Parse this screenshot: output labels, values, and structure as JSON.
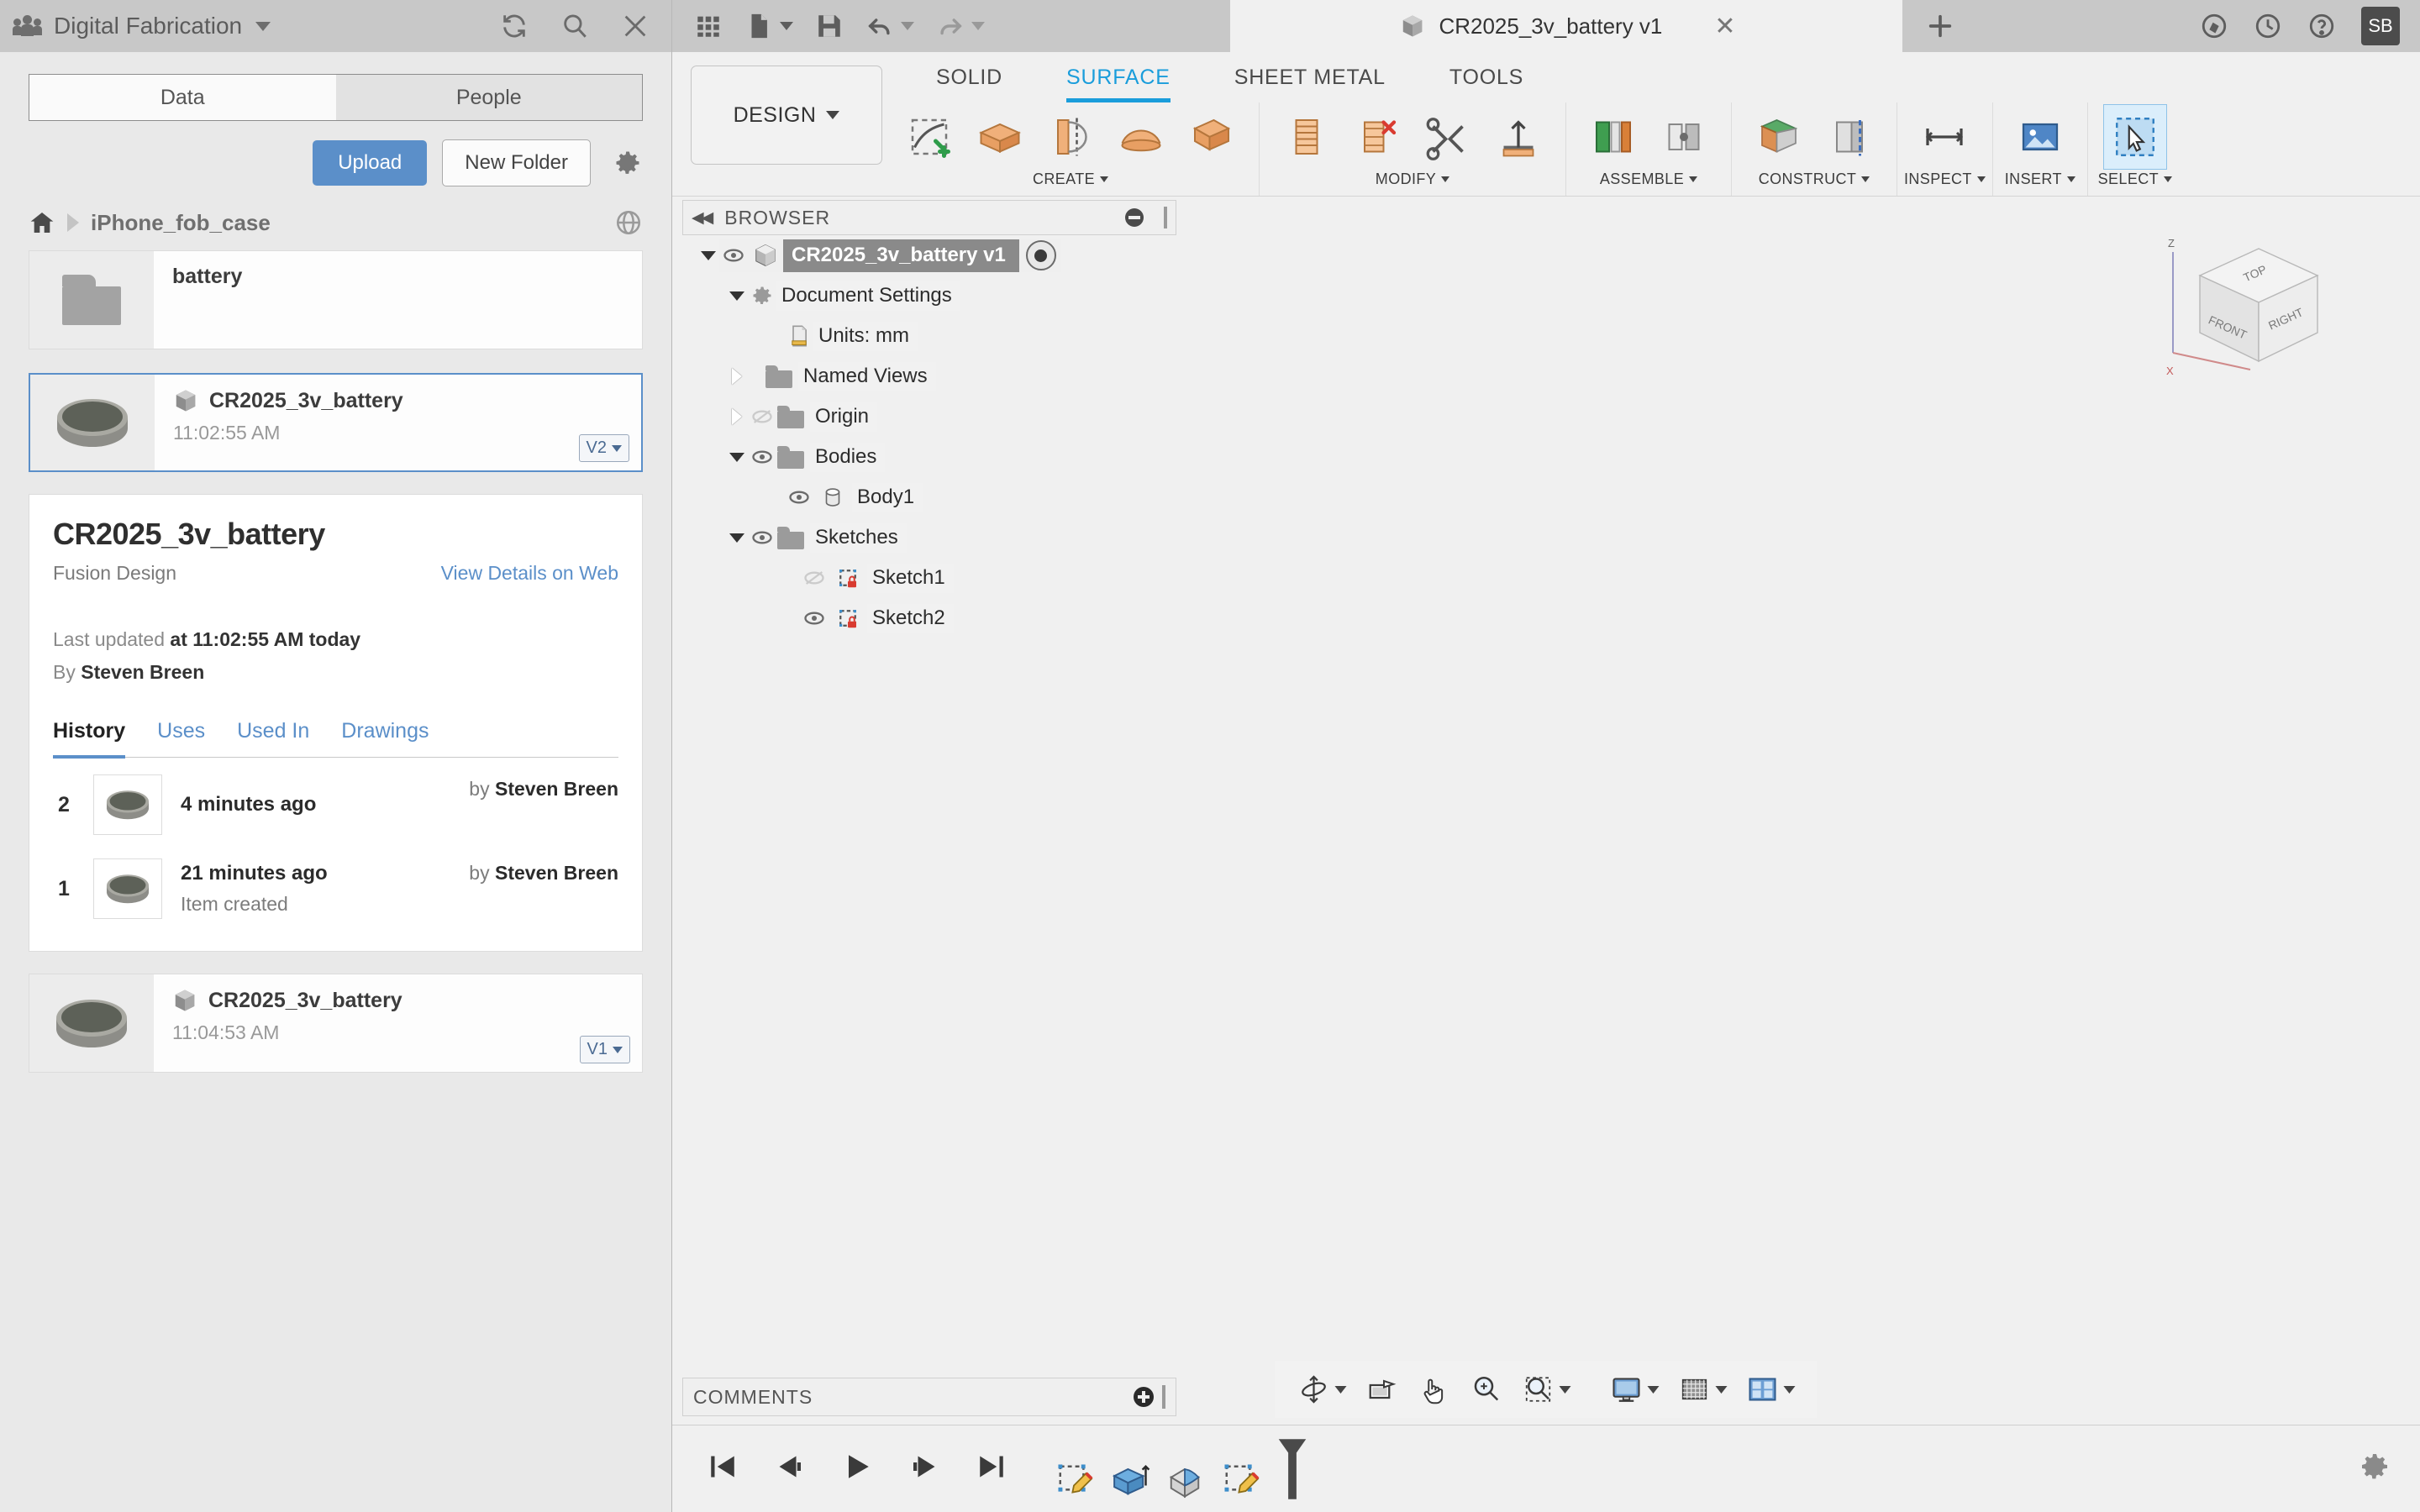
{
  "left_panel": {
    "hub_name": "Digital Fabrication",
    "hub_icon": "people-icon",
    "title_actions": [
      {
        "name": "refresh-icon",
        "label": "Refresh"
      },
      {
        "name": "search-icon",
        "label": "Search"
      },
      {
        "name": "close-icon",
        "label": "Close"
      }
    ],
    "tabs": [
      {
        "label": "Data",
        "active": true
      },
      {
        "label": "People",
        "active": false
      }
    ],
    "upload_label": "Upload",
    "new_folder_label": "New Folder",
    "settings_icon": "gear-icon",
    "breadcrumb": {
      "home_icon": "home-icon",
      "crumb": "iPhone_fob_case",
      "globe_icon": "globe-icon"
    },
    "items": [
      {
        "name": "battery",
        "type": "folder",
        "time": "",
        "version": "",
        "selected": false
      },
      {
        "name": "CR2025_3v_battery",
        "type": "design",
        "time": "11:02:55 AM",
        "version": "V2",
        "selected": true
      }
    ],
    "bottom_item": {
      "name": "CR2025_3v_battery",
      "type": "design",
      "time": "11:04:53 AM",
      "version": "V1",
      "selected": false
    },
    "detail": {
      "title": "CR2025_3v_battery",
      "subtype": "Fusion Design",
      "web_link": "View Details on Web",
      "updated_prefix": "Last updated ",
      "updated_value": "at 11:02:55 AM today",
      "author_prefix": "By ",
      "author_value": "Steven Breen",
      "tabs": [
        {
          "label": "History",
          "active": true
        },
        {
          "label": "Uses",
          "active": false
        },
        {
          "label": "Used In",
          "active": false
        },
        {
          "label": "Drawings",
          "active": false
        }
      ],
      "history": [
        {
          "num": "2",
          "when": "4 minutes ago",
          "note": "",
          "by_prefix": "by ",
          "by": "Steven Breen"
        },
        {
          "num": "1",
          "when": "21 minutes ago",
          "note": "Item created",
          "by_prefix": "by ",
          "by": "Steven Breen"
        }
      ]
    }
  },
  "fusion": {
    "quick_access": [
      {
        "name": "app-grid-icon",
        "label": "Show Data Panel"
      },
      {
        "name": "new-file-icon",
        "label": "File",
        "caret": true
      },
      {
        "name": "save-icon",
        "label": "Save"
      },
      {
        "name": "undo-icon",
        "label": "Undo",
        "caret": true
      },
      {
        "name": "redo-icon",
        "label": "Redo",
        "caret": true
      }
    ],
    "document_tab": {
      "icon": "cube-icon",
      "title": "CR2025_3v_battery v1",
      "close_icon": "close-icon"
    },
    "tab_add_icon": "plus-icon",
    "title_right": [
      {
        "name": "extensions-icon",
        "label": "Extensions"
      },
      {
        "name": "recent-icon",
        "label": "Recent"
      },
      {
        "name": "help-icon",
        "label": "Help"
      }
    ],
    "avatar_initials": "SB",
    "workspace_label": "DESIGN",
    "ribbon_tabs": [
      {
        "label": "SOLID",
        "active": false
      },
      {
        "label": "SURFACE",
        "active": true
      },
      {
        "label": "SHEET METAL",
        "active": false
      },
      {
        "label": "TOOLS",
        "active": false
      }
    ],
    "ribbon_panels": [
      {
        "label": "CREATE",
        "tools": [
          "sketch-icon",
          "extrude-icon",
          "revolve-icon",
          "loft-icon",
          "patch-icon",
          "offset-icon"
        ]
      },
      {
        "label": "MODIFY",
        "tools": [
          "trim-icon",
          "extend-icon",
          "stitch-icon",
          "unstitch-icon"
        ]
      },
      {
        "label": "ASSEMBLE",
        "tools": [
          "assemble-icon",
          "joint-icon"
        ]
      },
      {
        "label": "CONSTRUCT",
        "tools": [
          "plane-icon",
          "axis-icon"
        ]
      },
      {
        "label": "INSPECT",
        "tools": [
          "measure-icon"
        ]
      },
      {
        "label": "INSERT",
        "tools": [
          "insert-image-icon"
        ]
      },
      {
        "label": "SELECT",
        "tools": [
          "select-icon"
        ],
        "selected": true
      }
    ],
    "browser": {
      "title": "BROWSER",
      "collapse_icon": "collapse-left-icon",
      "minimize_icon": "minimize-icon",
      "nodes": [
        {
          "label": "CR2025_3v_battery v1",
          "icon": "cube-icon",
          "depth": 0,
          "arrow": "down",
          "eye": "visible",
          "root": true,
          "target": true
        },
        {
          "label": "Document Settings",
          "icon": "gear-icon",
          "depth": 1,
          "arrow": "down",
          "eye": "none"
        },
        {
          "label": "Units: mm",
          "icon": "ruler-doc-icon",
          "depth": 2,
          "arrow": "none",
          "eye": "none"
        },
        {
          "label": "Named Views",
          "icon": "folder-icon",
          "depth": 1,
          "arrow": "right",
          "eye": "none"
        },
        {
          "label": "Origin",
          "icon": "folder-icon",
          "depth": 1,
          "arrow": "right",
          "eye": "hidden"
        },
        {
          "label": "Bodies",
          "icon": "folder-icon",
          "depth": 1,
          "arrow": "down",
          "eye": "visible"
        },
        {
          "label": "Body1",
          "icon": "body-icon",
          "depth": 2,
          "arrow": "none",
          "eye": "visible"
        },
        {
          "label": "Sketches",
          "icon": "folder-icon",
          "depth": 1,
          "arrow": "down",
          "eye": "visible"
        },
        {
          "label": "Sketch1",
          "icon": "sketch-locked-icon",
          "depth": 2,
          "arrow": "none",
          "eye": "hidden"
        },
        {
          "label": "Sketch2",
          "icon": "sketch-locked-icon",
          "depth": 2,
          "arrow": "none",
          "eye": "visible"
        }
      ]
    },
    "viewcube": {
      "top_face": "TOP",
      "front_face": "FRONT",
      "right_face": "RIGHT",
      "axis_z": "Z",
      "axis_x": "X"
    },
    "comments": {
      "title": "COMMENTS",
      "add_icon": "plus-circle-icon"
    },
    "nav_toolbar": [
      {
        "name": "orbit-icon",
        "caret": true
      },
      {
        "name": "look-at-icon",
        "caret": false
      },
      {
        "name": "pan-icon",
        "caret": false
      },
      {
        "name": "zoom-icon",
        "caret": false
      },
      {
        "name": "zoom-window-icon",
        "caret": true
      },
      {
        "name": "display-settings-icon",
        "caret": true
      },
      {
        "name": "grid-snap-icon",
        "caret": true
      },
      {
        "name": "viewports-icon",
        "caret": true
      }
    ],
    "timeline": {
      "nav": [
        "go-to-beginning-icon",
        "step-back-icon",
        "play-icon",
        "step-forward-icon",
        "go-to-end-icon"
      ],
      "features": [
        "sketch-feature-icon",
        "extrude-feature-icon",
        "fillet-feature-icon",
        "sketch-feature-icon"
      ],
      "marker_icon": "timeline-marker-icon",
      "settings_icon": "gear-icon"
    }
  }
}
